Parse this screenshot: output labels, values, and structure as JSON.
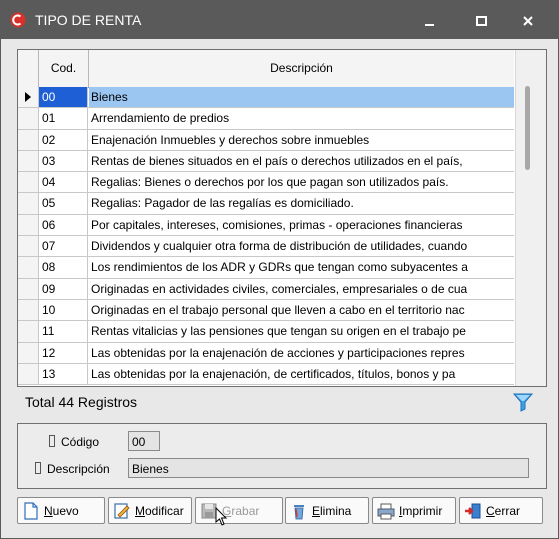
{
  "window": {
    "title": "TIPO DE RENTA"
  },
  "grid": {
    "columns": {
      "cod": "Cod.",
      "desc": "Descripción"
    },
    "selected_index": 0,
    "rows": [
      {
        "cod": "00",
        "desc": "Bienes"
      },
      {
        "cod": "01",
        "desc": "Arrendamiento de predios"
      },
      {
        "cod": "02",
        "desc": "Enajenación Inmuebles y derechos sobre inmuebles"
      },
      {
        "cod": "03",
        "desc": "Rentas de bienes situados en el país o derechos utilizados en el país,"
      },
      {
        "cod": "04",
        "desc": "Regalias: Bienes o derechos por los que pagan son utilizados país."
      },
      {
        "cod": "05",
        "desc": "Regalias: Pagador de las regalías es domiciliado."
      },
      {
        "cod": "06",
        "desc": "Por capitales,  intereses, comisiones, primas - operaciones financieras"
      },
      {
        "cod": "07",
        "desc": "Dividendos y cualquier otra forma de distribución de utilidades, cuando"
      },
      {
        "cod": "08",
        "desc": "Los rendimientos de los ADR y GDRs que tengan como subyacentes a"
      },
      {
        "cod": "09",
        "desc": "Originadas en actividades civiles, comerciales, empresariales o de cua"
      },
      {
        "cod": "10",
        "desc": "Originadas en el trabajo personal que lleven a cabo en el territorio nac"
      },
      {
        "cod": "11",
        "desc": "Rentas vitalicias y las pensiones que tengan su origen en el trabajo pe"
      },
      {
        "cod": "12",
        "desc": "Las obtenidas por la enajenación de acciones y participaciones repres"
      },
      {
        "cod": "13",
        "desc": "Las obtenidas por la enajenación,  de  certificados, títulos, bonos y pa"
      }
    ]
  },
  "total_label": "Total 44 Registros",
  "detail": {
    "codigo_label": "Código",
    "codigo_value": "00",
    "descripcion_label": "Descripción",
    "descripcion_value": "Bienes"
  },
  "buttons": {
    "nuevo": {
      "first": "N",
      "rest": "uevo"
    },
    "modificar": {
      "first": "M",
      "rest": "odificar"
    },
    "grabar": {
      "first": "G",
      "rest": "rabar"
    },
    "elimina": {
      "first": "E",
      "rest": "limina"
    },
    "imprimir": {
      "first": "I",
      "rest": "mprimir"
    },
    "cerrar": {
      "first": "C",
      "rest": "errar"
    }
  },
  "icons": {
    "app": "app-logo-icon",
    "minimize": "minimize-icon",
    "maximize": "maximize-icon",
    "close": "close-icon",
    "filter": "filter-icon"
  },
  "colors": {
    "titlebar": "#5a5a5a",
    "selection_code": "#1e5fd6",
    "selection_row": "#9cc6f2",
    "app_icon": "#d9302a"
  }
}
